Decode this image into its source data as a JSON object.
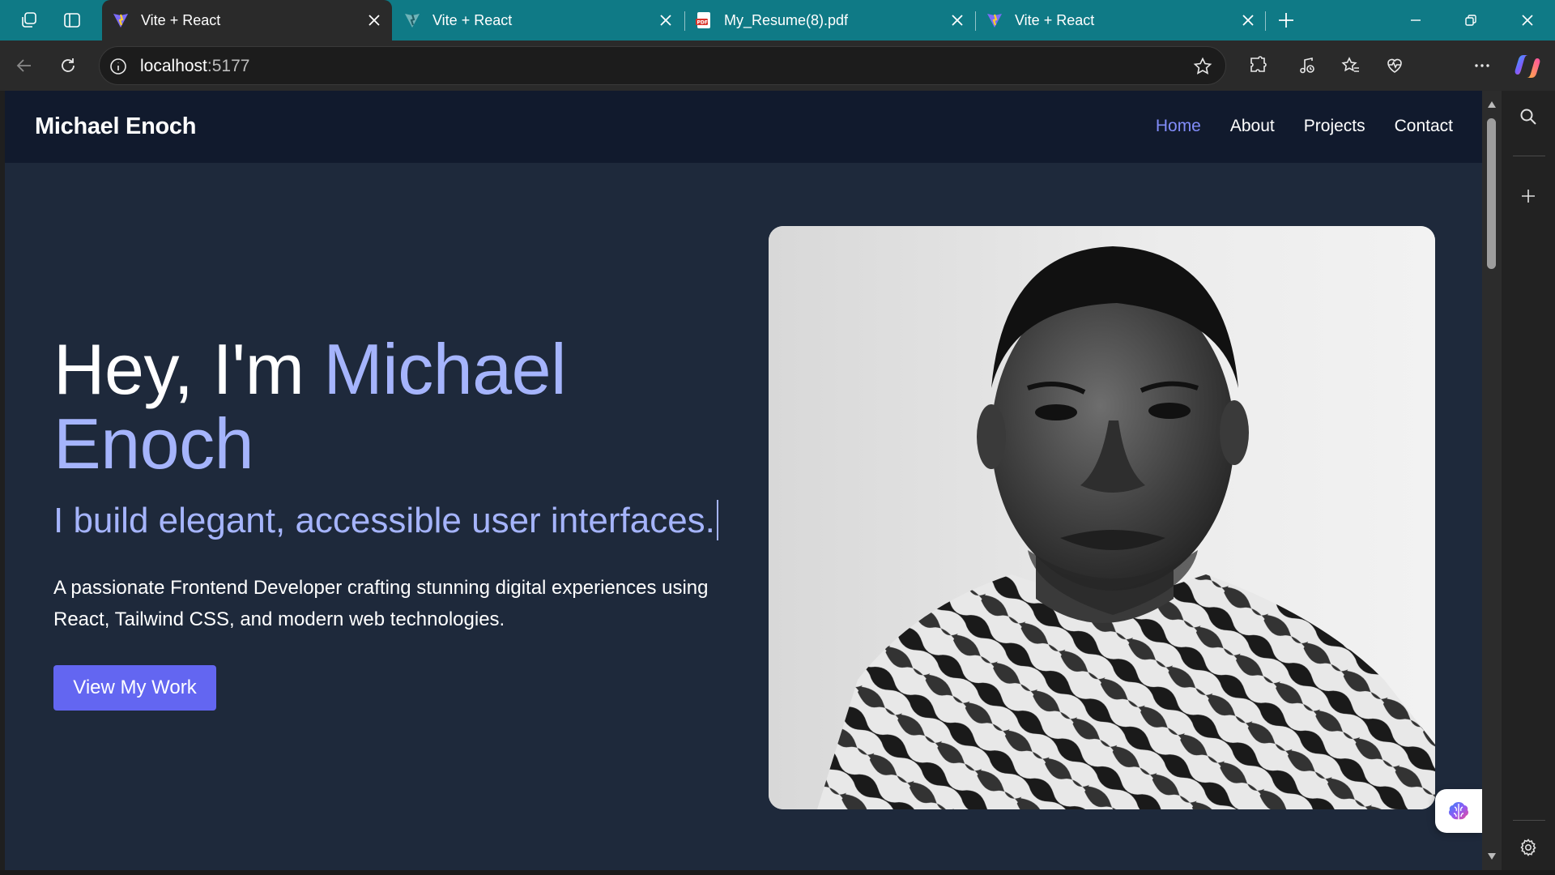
{
  "browser": {
    "tabs": [
      {
        "title": "Vite + React",
        "favicon": "vite-logo",
        "active": true
      },
      {
        "title": "Vite + React",
        "favicon": "vite-logo-muted",
        "active": false
      },
      {
        "title": "My_Resume(8).pdf",
        "favicon": "pdf-icon",
        "active": false
      },
      {
        "title": "Vite + React",
        "favicon": "vite-logo",
        "active": false
      }
    ],
    "address": {
      "host": "localhost",
      "port": ":5177"
    }
  },
  "site": {
    "brand": "Michael Enoch",
    "nav": [
      {
        "label": "Home",
        "active": true
      },
      {
        "label": "About",
        "active": false
      },
      {
        "label": "Projects",
        "active": false
      },
      {
        "label": "Contact",
        "active": false
      }
    ],
    "hero": {
      "greeting": "Hey, I'm",
      "name_first": "Michael",
      "name_last": "Enoch",
      "subtitle": "I build elegant, accessible user interfaces.",
      "description": "A passionate Frontend Developer crafting stunning digital experiences using React, Tailwind CSS, and modern web technologies.",
      "cta_label": "View My Work"
    }
  },
  "colors": {
    "page_bg": "#1e293b",
    "nav_bg": "#111a2d",
    "accent": "#a5b4fc",
    "nav_active": "#818cf8",
    "button": "#6366f1",
    "tab_strip": "#0f7a86"
  }
}
